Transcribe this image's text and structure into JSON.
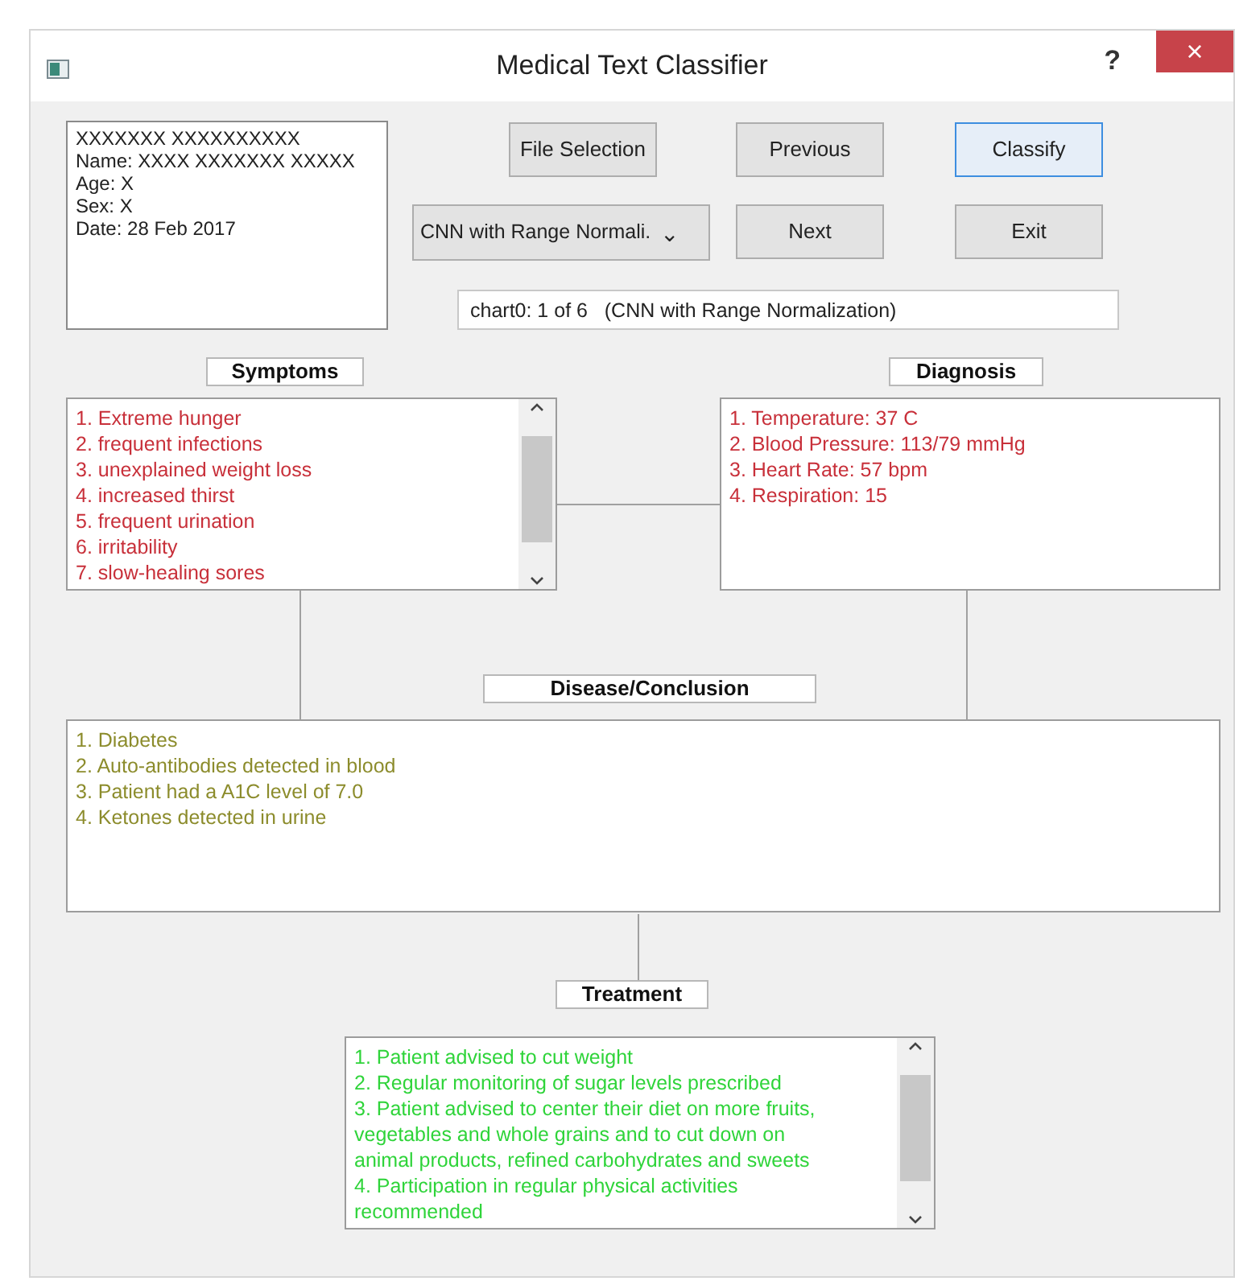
{
  "window": {
    "title": "Medical Text Classifier",
    "help": "?",
    "close": "×"
  },
  "patient_info": [
    "XXXXXXX XXXXXXXXXX",
    "Name: XXXX XXXXXXX XXXXX",
    "Age: X",
    "Sex: X",
    "Date: 28 Feb 2017"
  ],
  "buttons": [
    {
      "label": "File Selection",
      "focused": false
    },
    {
      "label": "Previous",
      "focused": false
    },
    {
      "label": "Classify",
      "focused": true
    },
    {
      "label": "Next",
      "focused": false
    },
    {
      "label": "Exit",
      "focused": false
    }
  ],
  "model_dropdown": {
    "value": "CNN with Range Normali.",
    "caret": "⌄"
  },
  "status_field": {
    "value": "chart0: 1 of 6   (CNN with Range Normalization)"
  },
  "panels": [
    {
      "title": "Symptoms",
      "color": "#c8303a",
      "scrollbar": true,
      "items": [
        "1. Extreme hunger",
        "2. frequent infections",
        "3. unexplained weight loss",
        "4. increased thirst",
        "5. frequent urination",
        "6. irritability",
        "7. slow-healing sores"
      ]
    },
    {
      "title": "Diagnosis",
      "color": "#c8303a",
      "scrollbar": false,
      "items": [
        "1. Temperature: 37 C",
        "2. Blood Pressure: 113/79 mmHg",
        "3. Heart Rate: 57 bpm",
        "4. Respiration: 15"
      ]
    },
    {
      "title": "Disease/Conclusion",
      "color": "#8c8c2c",
      "scrollbar": false,
      "items": [
        "1. Diabetes",
        "2. Auto-antibodies detected in blood",
        "3. Patient had a A1C level of 7.0",
        "4. Ketones detected in urine"
      ]
    },
    {
      "title": "Treatment",
      "color": "#2fd43a",
      "scrollbar": true,
      "items": [
        "1. Patient advised to cut weight",
        "2. Regular monitoring of sugar levels prescribed",
        "3. Patient advised to center their diet on more fruits, vegetables and whole grains and to cut down on animal products, refined carbohydrates and sweets",
        "4. Participation in regular physical activities recommended"
      ]
    }
  ]
}
